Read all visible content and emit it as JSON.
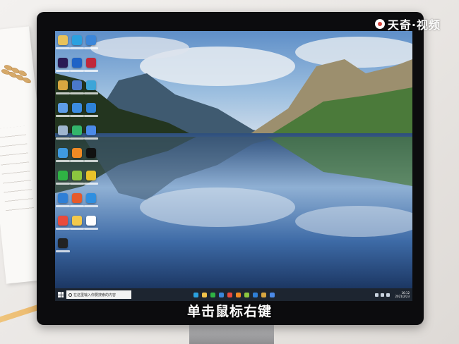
{
  "watermark": {
    "text": "天奇·视频"
  },
  "subtitle": "单击鼠标右键",
  "desktop": {
    "icons": [
      {
        "name": "this-pc",
        "color": "#e8c25a"
      },
      {
        "name": "edge",
        "color": "#2aa1e0"
      },
      {
        "name": "network",
        "color": "#3b86d9"
      },
      {
        "name": "premiere",
        "color": "#2a1a55"
      },
      {
        "name": "app-blue",
        "color": "#1f63c6"
      },
      {
        "name": "app-red",
        "color": "#c0283a"
      },
      {
        "name": "app-tool",
        "color": "#d7a640"
      },
      {
        "name": "app-folder",
        "color": "#4a78c9"
      },
      {
        "name": "app-chart",
        "color": "#3da5d8"
      },
      {
        "name": "app-cloud",
        "color": "#5e9de8"
      },
      {
        "name": "app-tv",
        "color": "#3b8be0"
      },
      {
        "name": "app-wifi",
        "color": "#2e82d8"
      },
      {
        "name": "recycle-bin",
        "color": "#9fb6cf"
      },
      {
        "name": "app-green",
        "color": "#33b56b"
      },
      {
        "name": "app-blue2",
        "color": "#4b8ae8"
      },
      {
        "name": "app-window",
        "color": "#3f9ae0"
      },
      {
        "name": "app-orange",
        "color": "#f08a24"
      },
      {
        "name": "tiktok",
        "color": "#111111"
      },
      {
        "name": "wechat",
        "color": "#2fb344"
      },
      {
        "name": "app-lime",
        "color": "#8cc63f"
      },
      {
        "name": "app-yellow",
        "color": "#e9c22a"
      },
      {
        "name": "app-shield",
        "color": "#2f7fd6"
      },
      {
        "name": "app-mosaic",
        "color": "#e55a2b"
      },
      {
        "name": "app-blue3",
        "color": "#2f8fe0"
      },
      {
        "name": "app-color",
        "color": "#e94b3c"
      },
      {
        "name": "app-gold",
        "color": "#f2c94c"
      },
      {
        "name": "app-pen",
        "color": "#ffffff"
      },
      {
        "name": "app-dark",
        "color": "#222222"
      }
    ]
  },
  "taskbar": {
    "search_placeholder": "在这里输入你要搜索的内容",
    "pinned": [
      "#2aa1e0",
      "#f0c24a",
      "#2fb344",
      "#3b86d9",
      "#e94b3c",
      "#f08a24",
      "#8cc63f",
      "#2f7fd6",
      "#d7a640",
      "#4b8ae8"
    ],
    "clock_time": "16:12",
    "clock_date": "2021/2/23"
  }
}
